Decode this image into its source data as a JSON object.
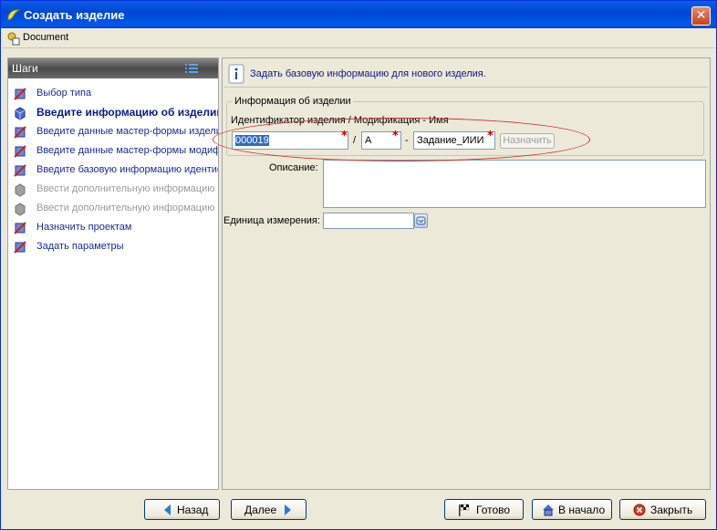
{
  "window": {
    "title": "Создать изделие",
    "close_glyph": "✕",
    "menu_label": "Document"
  },
  "steps": {
    "header": "Шаги",
    "items": [
      {
        "label": "Выбор типа",
        "state": "done"
      },
      {
        "label": "Введите информацию об изделии",
        "state": "active"
      },
      {
        "label": "Введите данные мастер-формы изделия",
        "state": "done"
      },
      {
        "label": "Введите данные мастер-формы модификации",
        "state": "done"
      },
      {
        "label": "Введите базовую информацию идентификатора",
        "state": "done"
      },
      {
        "label": "Ввести дополнительную информацию",
        "state": "disabled"
      },
      {
        "label": "Ввести дополнительную информацию",
        "state": "disabled"
      },
      {
        "label": "Назначить проектам",
        "state": "done"
      },
      {
        "label": "Задать параметры",
        "state": "done"
      }
    ]
  },
  "main": {
    "info_text": "Задать базовую информацию для нового изделия.",
    "group_title": "Информация об изделии",
    "id_caption": "Идентификатор изделия / Модификация - Имя",
    "id_value": "000019",
    "slash": "/",
    "revision_value": "A",
    "dash": "-",
    "name_value": "Задание_ИИИ",
    "assign_button": "Назначить",
    "description_label": "Описание:",
    "description_value": "",
    "unit_label": "Единица измерения:",
    "unit_value": ""
  },
  "footer": {
    "back": "Назад",
    "next": "Далее",
    "finish": "Готово",
    "home": "В начало",
    "close": "Закрыть"
  }
}
